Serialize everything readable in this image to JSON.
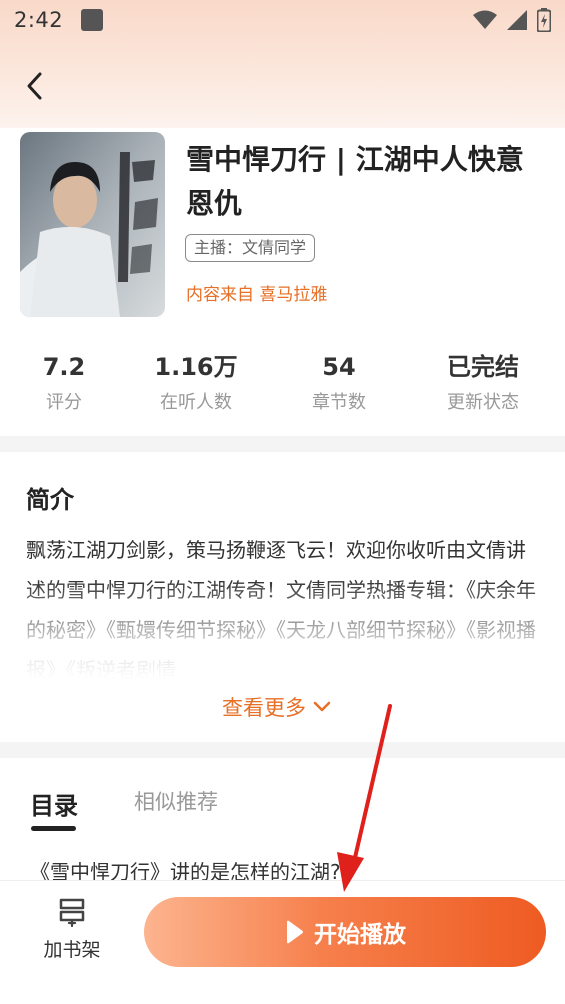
{
  "status_bar": {
    "time": "2:42"
  },
  "album": {
    "title": "雪中悍刀行 | 江湖中人快意恩仇",
    "host_tag": "主播：文倩同学",
    "source": "内容来自 喜马拉雅"
  },
  "stats": [
    {
      "value": "7.2",
      "label": "评分"
    },
    {
      "value": "1.16万",
      "label": "在听人数"
    },
    {
      "value": "54",
      "label": "章节数"
    },
    {
      "value": "已完结",
      "label": "更新状态"
    }
  ],
  "intro": {
    "heading": "简介",
    "text": "飘荡江湖刀剑影，策马扬鞭逐飞云！欢迎你收听由文倩讲述的雪中悍刀行的江湖传奇！文倩同学热播专辑：《庆余年的秘密》《甄嬛传细节探秘》《天龙八部细节探秘》《影视播报》《叛逆者剧情",
    "see_more": "查看更多"
  },
  "tabs": {
    "catalog": "目录",
    "similar": "相似推荐"
  },
  "episodes": [
    "《雪中悍刀行》讲的是怎样的江湖?"
  ],
  "bottom": {
    "shelf_label": "加书架",
    "play_label": "开始播放"
  },
  "colors": {
    "accent": "#e76f26",
    "play_start": "#fcb48f",
    "play_end": "#ee5b22",
    "arrow": "#e0201b"
  }
}
